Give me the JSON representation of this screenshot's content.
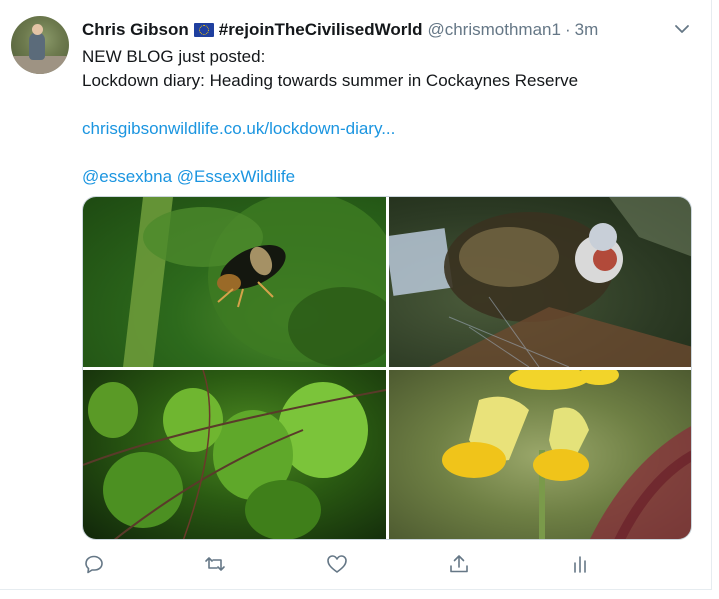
{
  "tweet": {
    "author_name": "Chris Gibson",
    "hashtag": "#rejoinTheCivilisedWorld",
    "handle": "@chrismothman1",
    "separator": "·",
    "time": "3m",
    "text_line1": "NEW BLOG just posted:",
    "text_line2": "Lockdown diary: Heading towards summer in Cockaynes Reserve",
    "link": "chrisgibsonwildlife.co.uk/lockdown-diary...",
    "mention1": "@essexbna",
    "mention2": "@EssexWildlife"
  },
  "media": {
    "images": [
      "beetle-on-leaf-photo",
      "dragonfly-closeup-photo",
      "birch-leaves-photo",
      "yellow-cowslip-flowers-photo"
    ]
  },
  "actions": [
    "reply-icon",
    "retweet-icon",
    "like-icon",
    "share-icon",
    "analytics-icon"
  ],
  "colors": {
    "link": "#1b95e0",
    "secondary_text": "#657786",
    "primary_text": "#14171a"
  }
}
